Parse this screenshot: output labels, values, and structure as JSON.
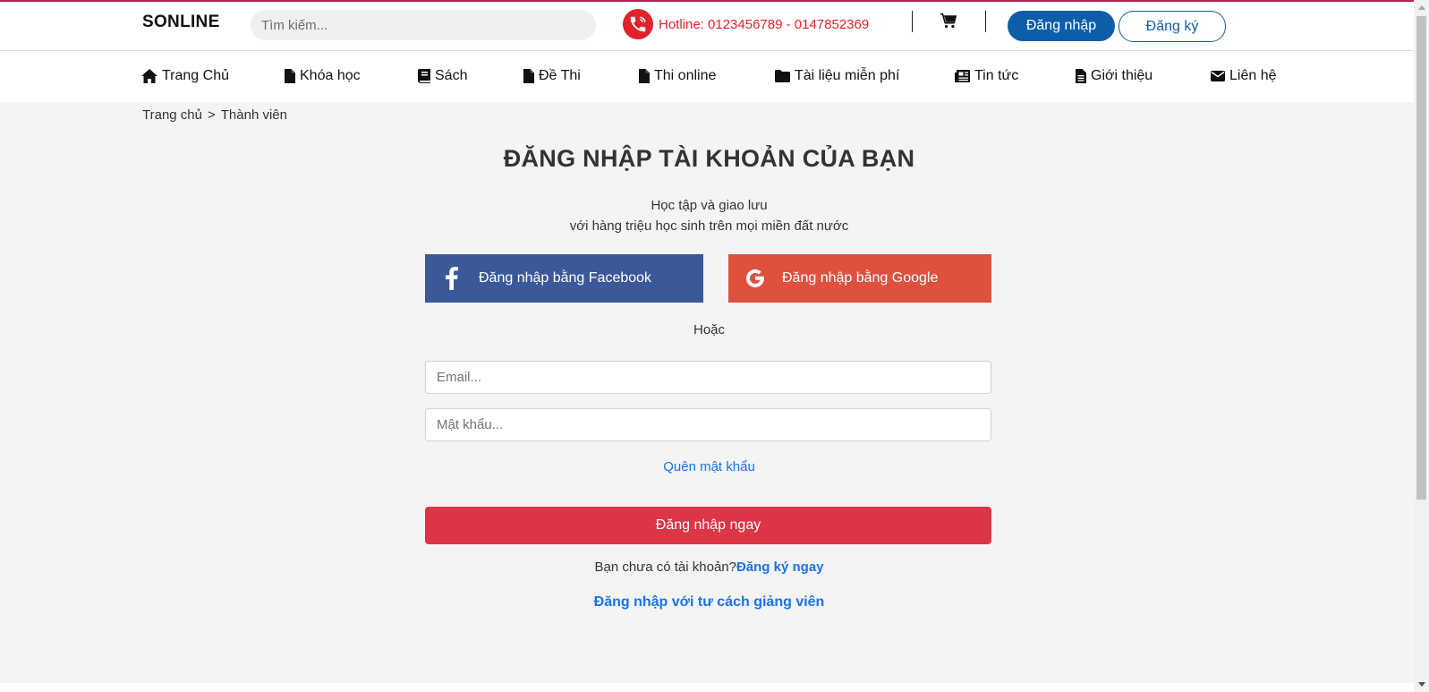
{
  "header": {
    "logo": "SONLINE",
    "search_placeholder": "Tìm kiếm...",
    "hotline": "Hotline: 0123456789 - 0147852369",
    "login_label": "Đăng nhập",
    "register_label": "Đăng ký"
  },
  "nav": {
    "items": [
      {
        "label": "Trang Chủ",
        "icon": "home-icon"
      },
      {
        "label": "Khóa học",
        "icon": "file-icon"
      },
      {
        "label": "Sách",
        "icon": "book-icon"
      },
      {
        "label": "Đề Thi",
        "icon": "file-icon"
      },
      {
        "label": "Thi online",
        "icon": "file-icon"
      },
      {
        "label": "Tài liệu miễn phí",
        "icon": "folder-icon"
      },
      {
        "label": "Tin tức",
        "icon": "newspaper-icon"
      },
      {
        "label": "Giới thiệu",
        "icon": "file-text-icon"
      },
      {
        "label": "Liên hệ",
        "icon": "envelope-icon"
      }
    ]
  },
  "breadcrumb": {
    "home": "Trang chủ",
    "separator": ">",
    "current": "Thành viên"
  },
  "login": {
    "title": "ĐĂNG NHẬP TÀI KHOẢN CỦA BẠN",
    "subtitle_line1": "Học tập và giao lưu",
    "subtitle_line2": "với hàng triệu học sinh trên mọi miền đất nước",
    "facebook_label": "Đăng nhập bằng Facebook",
    "google_label": "Đăng nhập bằng Google",
    "or_label": "Hoặc",
    "email_placeholder": "Email...",
    "password_placeholder": "Mật khẩu...",
    "forgot_label": "Quên mật khẩu",
    "submit_label": "Đăng nhập ngay",
    "no_account_text": "Bạn chưa có tài khoản?",
    "register_now_label": "Đăng ký ngay",
    "teacher_login_label": "Đăng nhập với tư cách giảng viên"
  },
  "colors": {
    "brand_blue": "#0d5ea8",
    "hotline_red": "#e1222c",
    "facebook": "#3b5998",
    "google": "#e0503f",
    "submit_red": "#dc3545",
    "link_blue": "#1a73e8",
    "page_bg": "#f4f4f4"
  }
}
